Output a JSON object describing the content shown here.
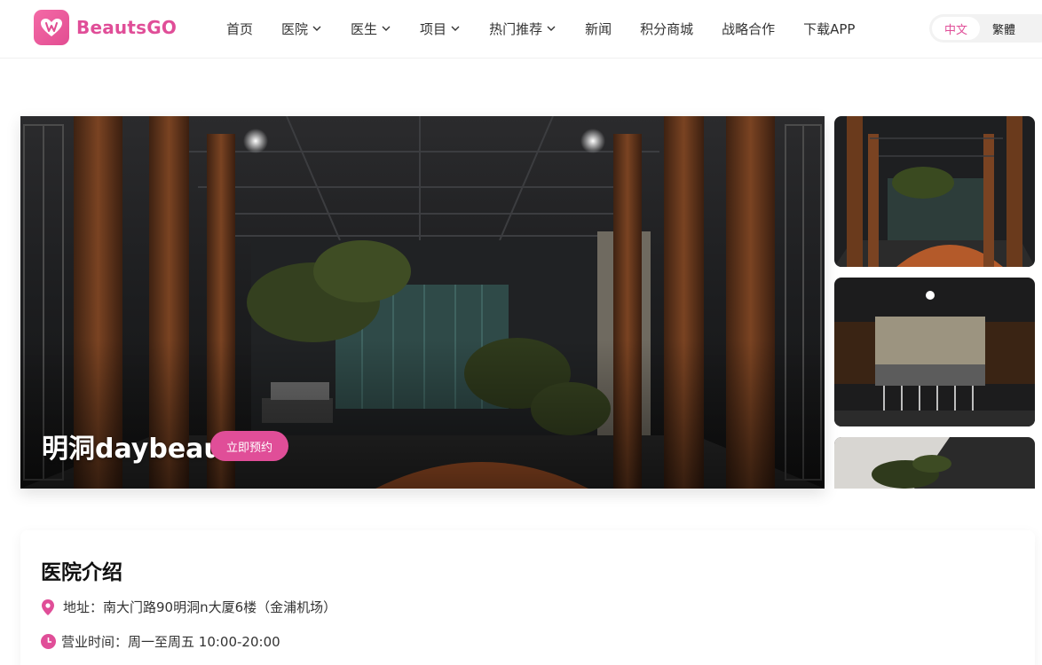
{
  "brand": {
    "name": "BeautsGO",
    "accent": "#e04e98"
  },
  "nav": {
    "items": [
      {
        "label": "首页",
        "dropdown": false
      },
      {
        "label": "医院",
        "dropdown": true
      },
      {
        "label": "医生",
        "dropdown": true
      },
      {
        "label": "项目",
        "dropdown": true
      },
      {
        "label": "热门推荐",
        "dropdown": true
      },
      {
        "label": "新闻",
        "dropdown": false
      },
      {
        "label": "积分商城",
        "dropdown": false
      },
      {
        "label": "战略合作",
        "dropdown": false
      },
      {
        "label": "下载APP",
        "dropdown": false
      }
    ]
  },
  "lang": {
    "zh_cn": "中文",
    "zh_tw": "繁體",
    "active": "中文"
  },
  "hero": {
    "title": "明洞daybeau",
    "book_label": "立即预约"
  },
  "gallery": {
    "thumb_icons": [
      "lobby-photo",
      "reception-photo",
      "plant-corner-photo"
    ]
  },
  "intro": {
    "title": "医院介绍",
    "address_label": "地址：",
    "address": "南大门路90明洞n大厦6楼（金浦机场）",
    "hours_label": "营业时间：",
    "hours": "周一至周五 10:00-20:00"
  },
  "icons": {
    "pin": "map-pin-icon",
    "clock": "clock-icon"
  }
}
